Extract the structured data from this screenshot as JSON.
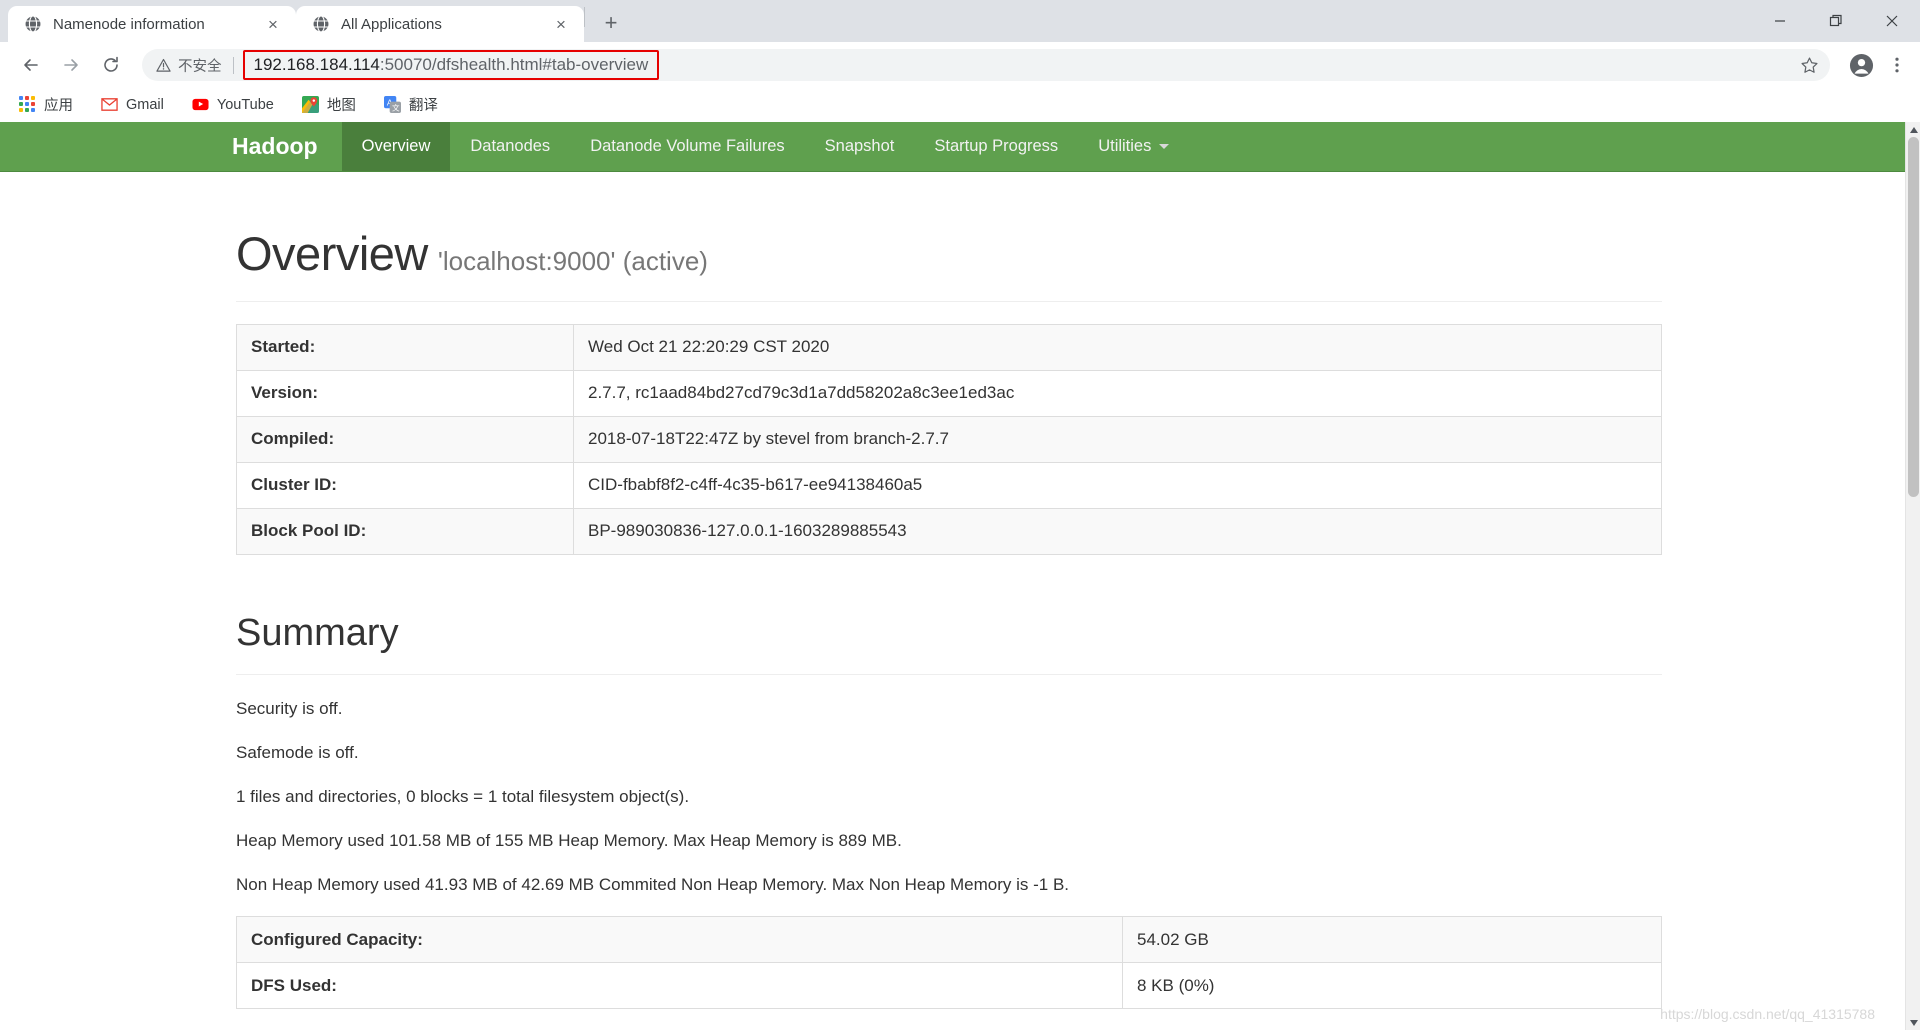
{
  "browser": {
    "tabs": [
      {
        "title": "Namenode information",
        "favicon": "globe-icon",
        "active": true,
        "close_label": "×"
      },
      {
        "title": "All Applications",
        "favicon": "globe-icon",
        "active": false,
        "close_label": "×"
      }
    ],
    "new_tab_label": "+",
    "window_controls": {
      "minimize": "—",
      "maximize": "❐",
      "close": "✕"
    },
    "toolbar": {
      "back_label": "←",
      "forward_label": "→",
      "reload_label": "⟳",
      "security_label": "不安全",
      "url_host": "192.168.184.114",
      "url_rest": ":50070/dfshealth.html#tab-overview",
      "star_label": "☆",
      "menu_label": "⋮"
    },
    "bookmarks": [
      {
        "label": "应用",
        "icon": "apps-grid-icon"
      },
      {
        "label": "Gmail",
        "icon": "gmail-icon"
      },
      {
        "label": "YouTube",
        "icon": "youtube-icon"
      },
      {
        "label": "地图",
        "icon": "maps-icon"
      },
      {
        "label": "翻译",
        "icon": "translate-icon"
      }
    ]
  },
  "hadoop": {
    "brand": "Hadoop",
    "nav": [
      {
        "label": "Overview",
        "active": true
      },
      {
        "label": "Datanodes",
        "active": false
      },
      {
        "label": "Datanode Volume Failures",
        "active": false
      },
      {
        "label": "Snapshot",
        "active": false
      },
      {
        "label": "Startup Progress",
        "active": false
      },
      {
        "label": "Utilities",
        "active": false,
        "dropdown": true
      }
    ],
    "brand_color": "#5fa04e",
    "active_color": "#4a7f3c"
  },
  "overview": {
    "title": "Overview",
    "subtitle": "'localhost:9000' (active)",
    "rows": [
      {
        "key": "Started:",
        "value": "Wed Oct 21 22:20:29 CST 2020"
      },
      {
        "key": "Version:",
        "value": "2.7.7, rc1aad84bd27cd79c3d1a7dd58202a8c3ee1ed3ac"
      },
      {
        "key": "Compiled:",
        "value": "2018-07-18T22:47Z by stevel from branch-2.7.7"
      },
      {
        "key": "Cluster ID:",
        "value": "CID-fbabf8f2-c4ff-4c35-b617-ee94138460a5"
      },
      {
        "key": "Block Pool ID:",
        "value": "BP-989030836-127.0.0.1-1603289885543"
      }
    ]
  },
  "summary": {
    "title": "Summary",
    "lines": [
      "Security is off.",
      "Safemode is off.",
      "1 files and directories, 0 blocks = 1 total filesystem object(s).",
      "Heap Memory used 101.58 MB of 155 MB Heap Memory. Max Heap Memory is 889 MB.",
      "Non Heap Memory used 41.93 MB of 42.69 MB Commited Non Heap Memory. Max Non Heap Memory is -1 B."
    ],
    "capacity_rows": [
      {
        "key": "Configured Capacity:",
        "value": "54.02 GB"
      },
      {
        "key": "DFS Used:",
        "value": "8 KB (0%)"
      }
    ]
  },
  "watermark": "https://blog.csdn.net/qq_41315788"
}
